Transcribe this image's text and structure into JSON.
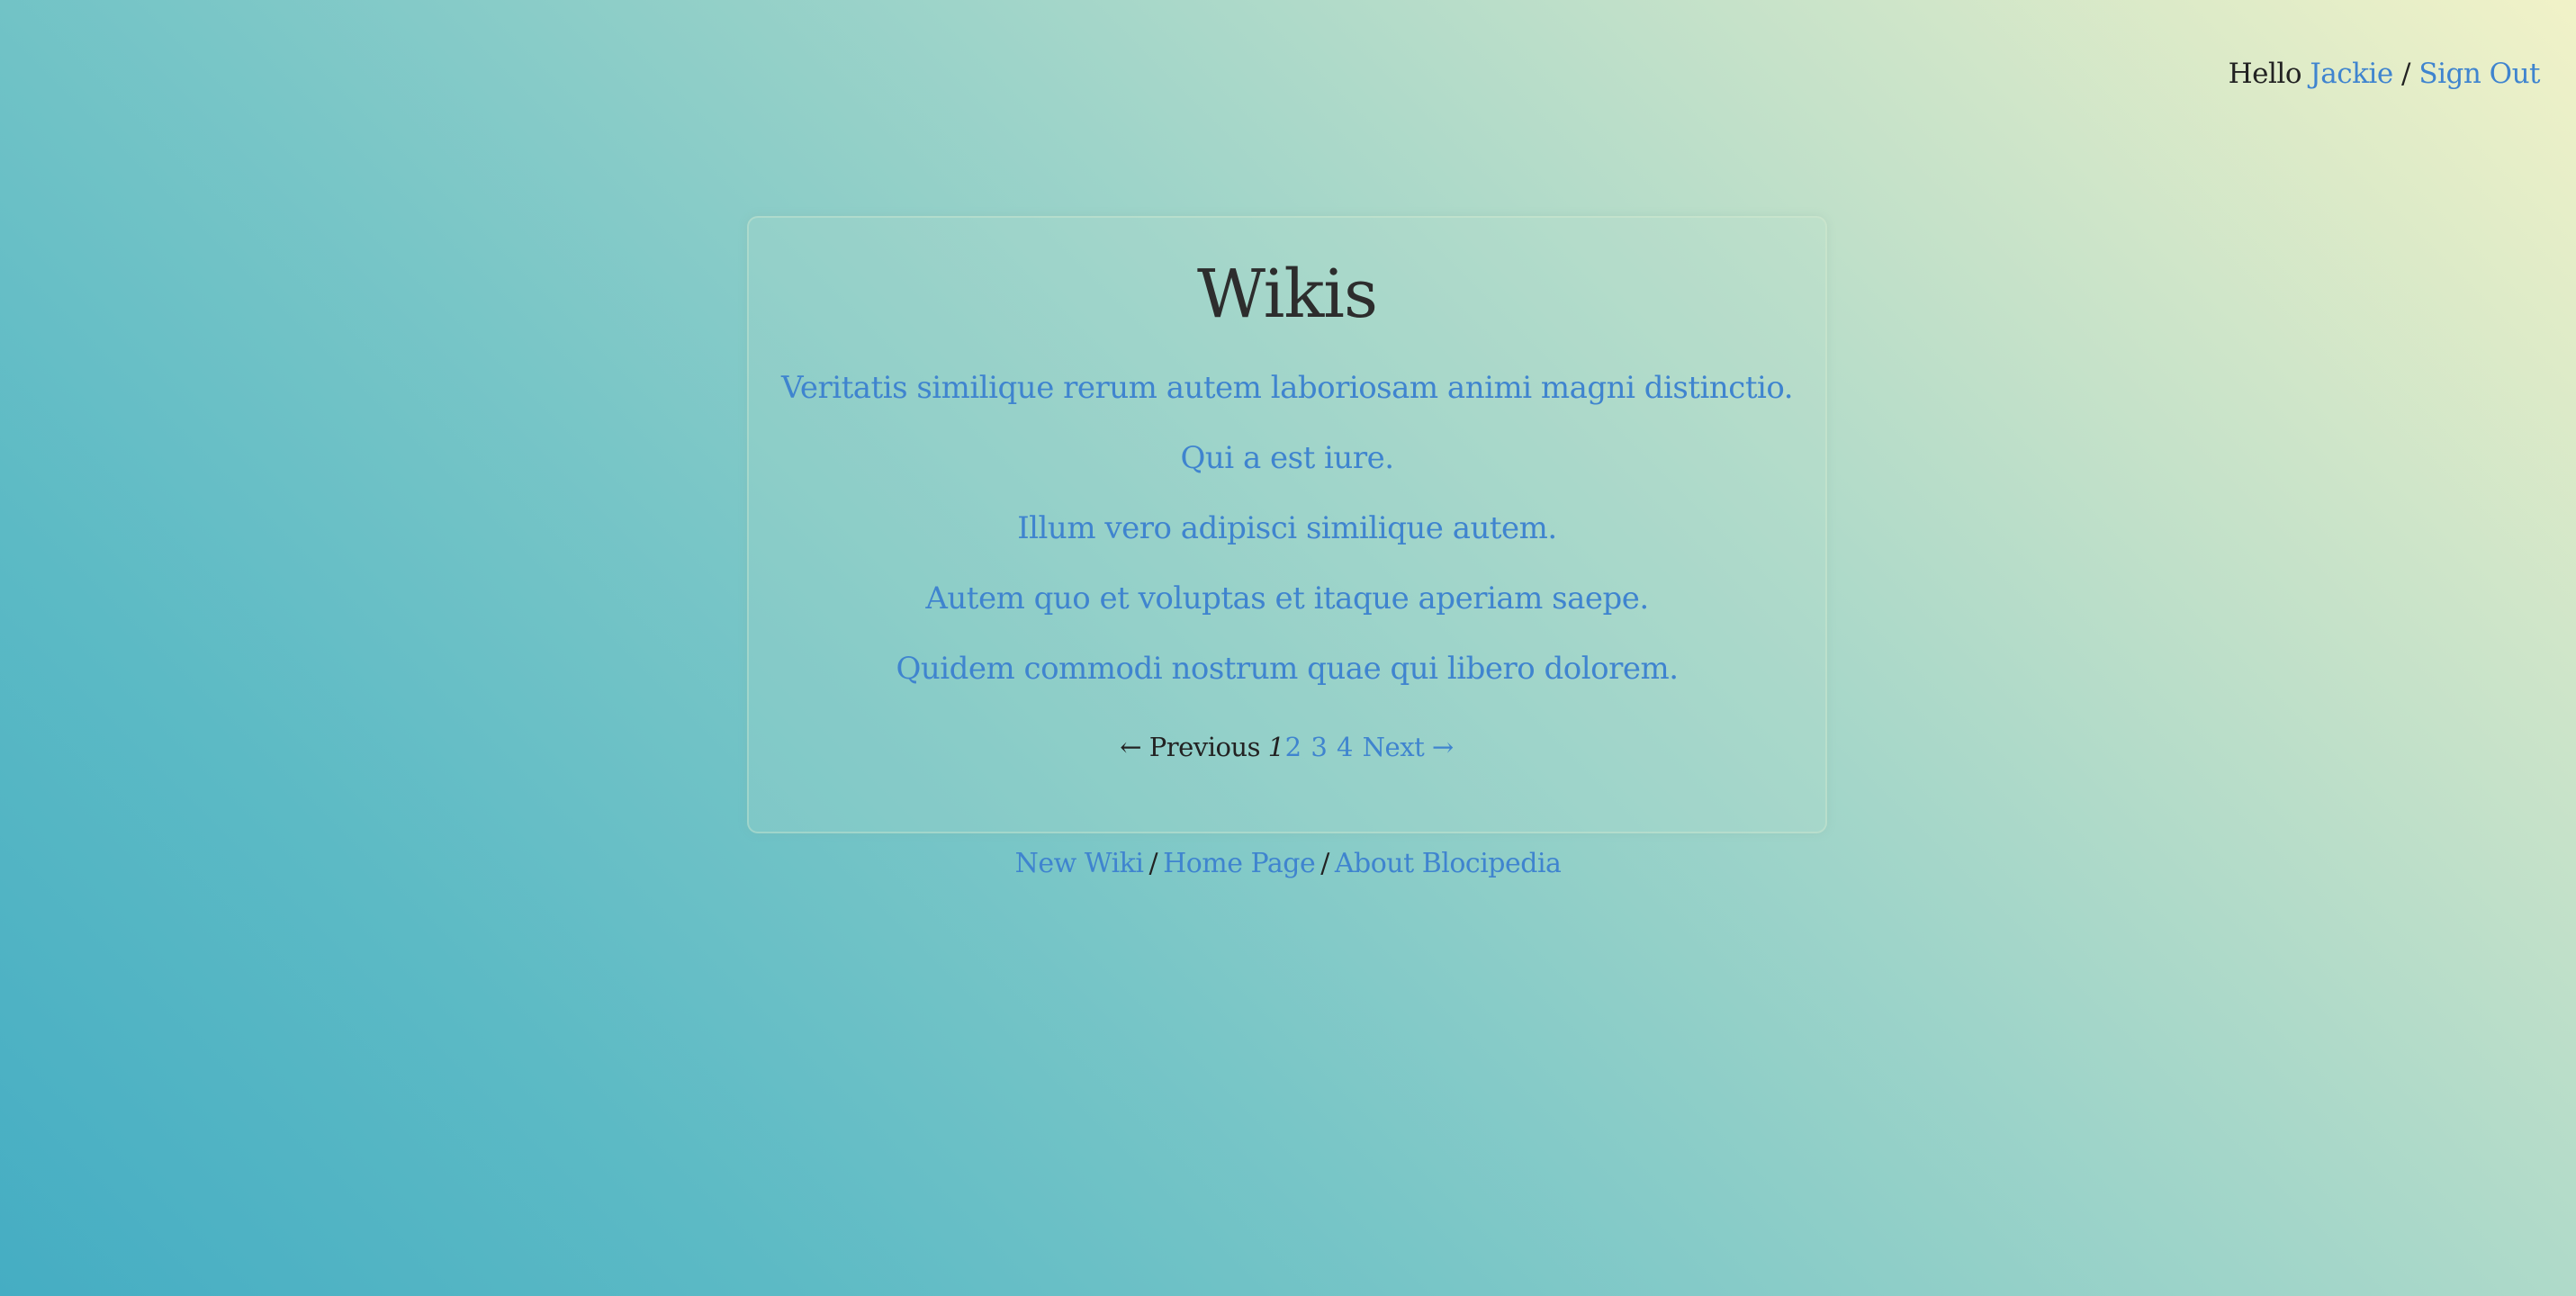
{
  "header": {
    "greeting": "Hello",
    "user_link": "Jackie",
    "separator": "/",
    "sign_out": "Sign Out"
  },
  "main": {
    "title": "Wikis",
    "wikis": [
      "Veritatis similique rerum autem laboriosam animi magni distinctio.",
      "Qui a est iure.",
      "Illum vero adipisci similique autem.",
      "Autem quo et voluptas et itaque aperiam saepe.",
      "Quidem commodi nostrum quae qui libero dolorem."
    ],
    "pagination": {
      "previous": "← Previous",
      "current_page": "1",
      "pages": [
        "2",
        "3",
        "4"
      ],
      "next": "Next →"
    }
  },
  "footer": {
    "new_wiki": "New Wiki",
    "home_page": "Home Page",
    "about": "About Blocipedia",
    "separator": "/"
  },
  "colors": {
    "link": "#3f84cf",
    "text": "#222222",
    "gradient_top_right": "#f1f2c8",
    "gradient_bottom_left": "#45adc3"
  }
}
